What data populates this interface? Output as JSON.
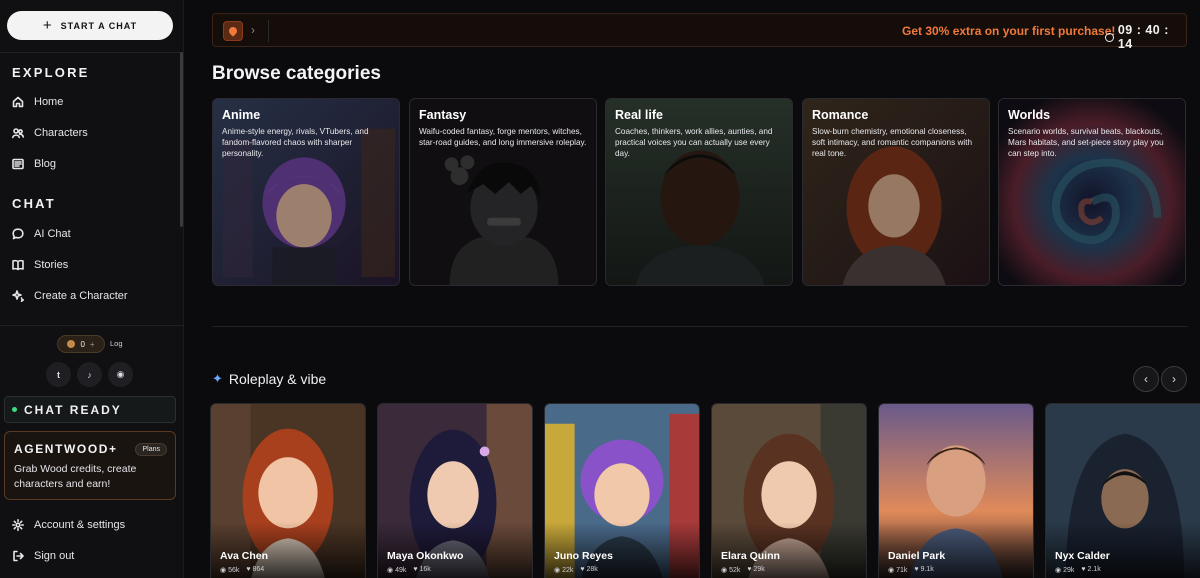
{
  "sidebar": {
    "start_chat": "START A CHAT",
    "explore_title": "EXPLORE",
    "explore_items": [
      {
        "label": "Home",
        "icon": "home-icon"
      },
      {
        "label": "Characters",
        "icon": "users-icon"
      },
      {
        "label": "Blog",
        "icon": "newspaper-icon"
      }
    ],
    "chat_title": "CHAT",
    "chat_items": [
      {
        "label": "AI Chat",
        "icon": "chat-bubble-icon"
      },
      {
        "label": "Stories",
        "icon": "book-icon"
      },
      {
        "label": "Create a Character",
        "icon": "sparkle-icon"
      }
    ],
    "credits_value": "0",
    "log_link": "Log",
    "socials": [
      "twitter-icon",
      "tiktok-icon",
      "discord-icon"
    ],
    "chat_ready": "CHAT READY",
    "plus_card": {
      "title": "AGENTWOOD+",
      "badge": "Plans",
      "desc": "Grab Wood credits, create characters and earn!"
    },
    "account": "Account & settings",
    "sign_out": "Sign out"
  },
  "promo": {
    "offer": "Get 30% extra on your first purchase!",
    "timer": "09 : 40 : 14"
  },
  "browse": {
    "title": "Browse categories",
    "categories": [
      {
        "title": "Anime",
        "desc": "Anime-style energy, rivals, VTubers, and fandom-flavored chaos with sharper personality."
      },
      {
        "title": "Fantasy",
        "desc": "Waifu-coded fantasy, forge mentors, witches, star-road guides, and long immersive roleplay."
      },
      {
        "title": "Real life",
        "desc": "Coaches, thinkers, work allies, aunties, and practical voices you can actually use every day."
      },
      {
        "title": "Romance",
        "desc": "Slow-burn chemistry, emotional closeness, soft intimacy, and romantic companions with real tone."
      },
      {
        "title": "Worlds",
        "desc": "Scenario worlds, survival beats, blackouts, Mars habitats, and set-piece story play you can step into."
      }
    ]
  },
  "roleplay": {
    "title": "Roleplay & vibe",
    "characters": [
      {
        "name": "Ava Chen",
        "views": "56k",
        "likes": "864"
      },
      {
        "name": "Maya Okonkwo",
        "views": "49k",
        "likes": "16k"
      },
      {
        "name": "Juno Reyes",
        "views": "22k",
        "likes": "28k"
      },
      {
        "name": "Elara Quinn",
        "views": "52k",
        "likes": "29k"
      },
      {
        "name": "Daniel Park",
        "views": "71k",
        "likes": "9.1k"
      },
      {
        "name": "Nyx Calder",
        "views": "29k",
        "likes": "2.1k"
      }
    ]
  },
  "colors": {
    "accent_orange": "#f07a3a",
    "ready_green": "#3ddc84",
    "background": "#0b0b0d"
  }
}
